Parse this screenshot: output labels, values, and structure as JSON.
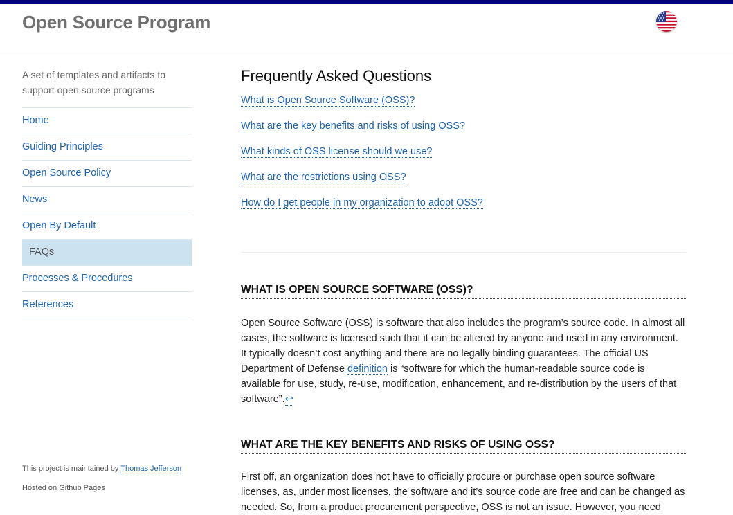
{
  "header": {
    "site_title": "Open Source Program",
    "flag_icon": "us-flag-icon"
  },
  "sidebar": {
    "tagline": "A set of templates and artifacts to support open source programs",
    "items": [
      {
        "label": "Home"
      },
      {
        "label": "Guiding Principles"
      },
      {
        "label": "Open Source Policy"
      },
      {
        "label": "News"
      },
      {
        "label": "Open By Default"
      },
      {
        "label": "FAQs",
        "active": true
      },
      {
        "label": "Processes & Procedures"
      },
      {
        "label": "References"
      }
    ],
    "maintained_prefix": "This project is maintained by ",
    "maintainer": "Thomas Jefferson",
    "hosted": "Hosted on Github Pages"
  },
  "main": {
    "title": "Frequently Asked Questions",
    "faq_links": [
      "What is Open Source Software (OSS)?",
      "What are the key benefits and risks of using OSS?",
      "What kinds of OSS license should we use?",
      "What are the restrictions using OSS?",
      "How do I get people in my organization to adopt OSS?"
    ],
    "section1": {
      "heading": "WHAT IS OPEN SOURCE SOFTWARE (OSS)?",
      "text_before": "Open Source Software (OSS) is software that also includes the program’s source code. In almost all cases, the software is licensed such that it can be altered by anyone and used in any environment. It typically doesn’t cost anything and there are no legally binding guarantees. The official US Department of Defense ",
      "link": "definition",
      "text_after": " is “software for which the human-readable source code is available for use, study, re-use, modification, enhancement, and re-distribution by the users of that software”.",
      "return_glyph": "↩"
    },
    "section2": {
      "heading": "WHAT ARE THE KEY BENEFITS AND RISKS OF USING OSS?",
      "text": "First off, an organization does not have to officially procure or purchase open source software licenses, as, under most licenses, the software and it’s source code are free and can be changed as needed. So, from a product procurement perspective, OSS is not an issue. However, you need"
    }
  },
  "colors": {
    "top_bar": "#00007f",
    "link": "#1f64b3",
    "active_nav_bg": "#cde2f0"
  }
}
